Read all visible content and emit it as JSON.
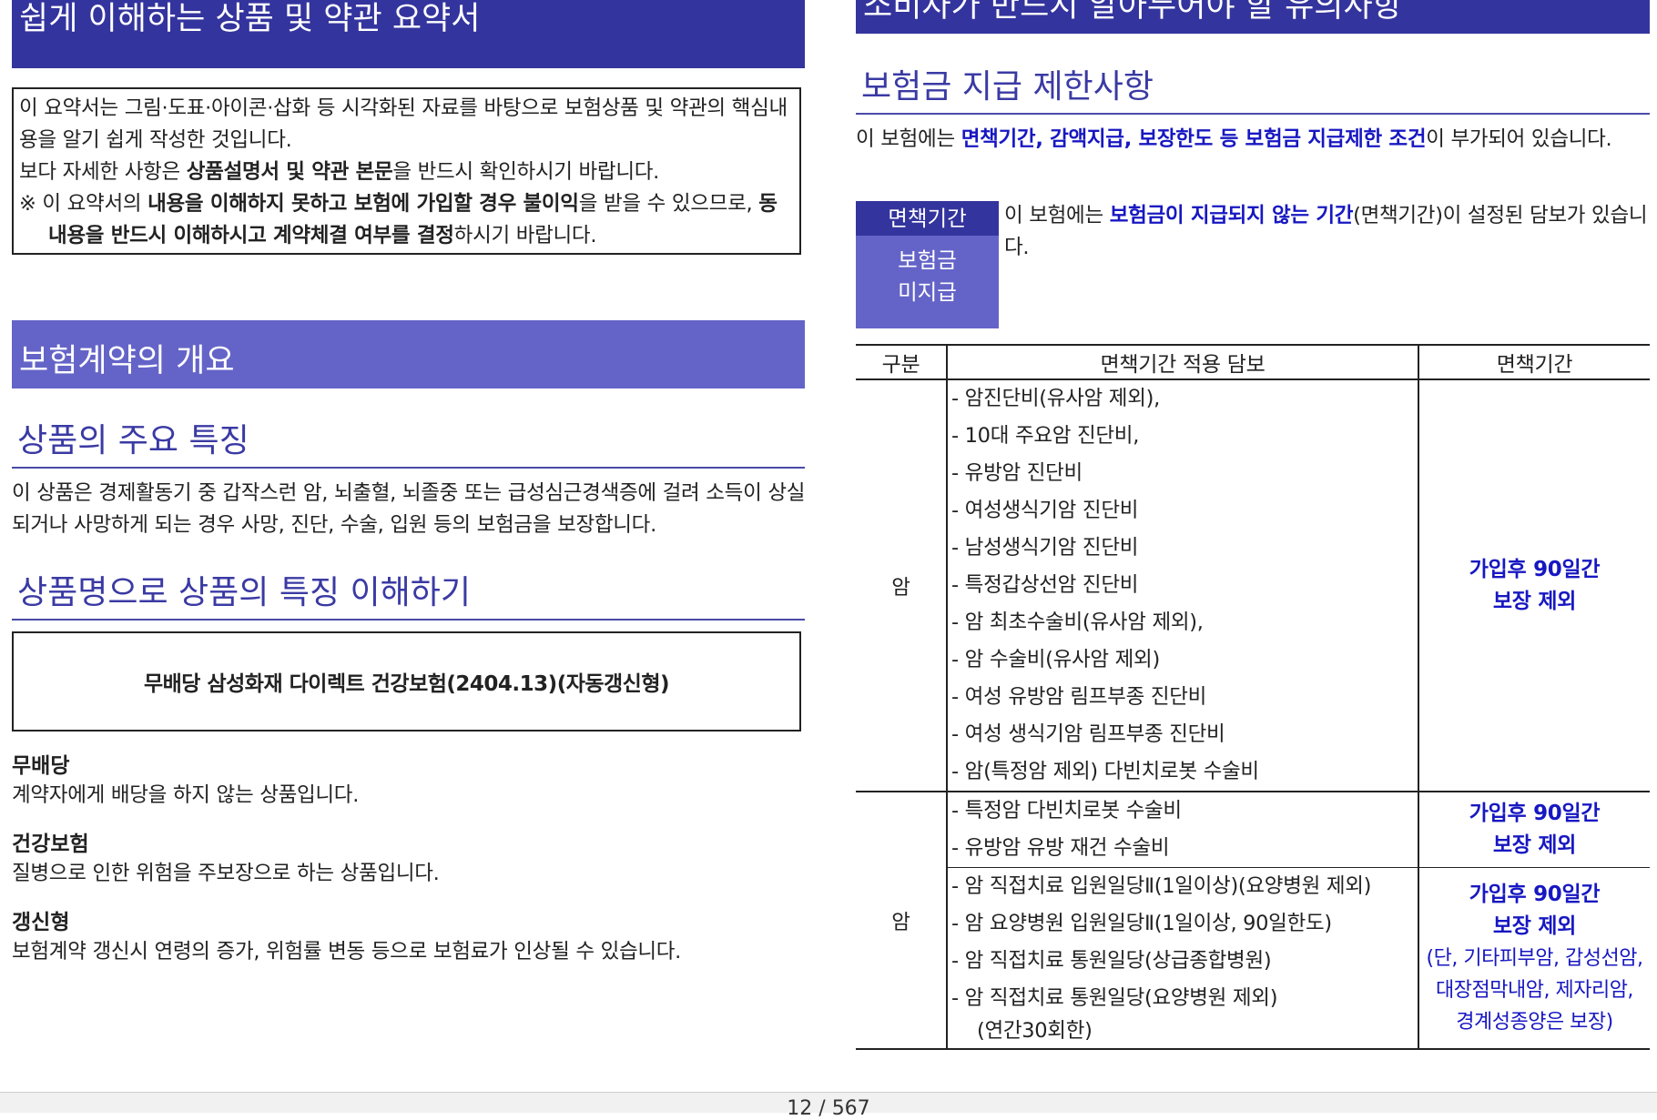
{
  "left": {
    "summary_title": "쉽게 이해하는 상품 및 약관 요약서",
    "intro": {
      "line1": "이 요약서는 그림·도표·아이콘·삽화 등 시각화된 자료를 바탕으로 보험상품 및 약관의 핵심내용을 알기 쉽게 작성한 것입니다.",
      "line2_a": "보다 자세한 사항은 ",
      "line2_b": "상품설명서 및 약관 본문",
      "line2_c": "을 반드시 확인하시기 바랍니다.",
      "note_a": "※ 이 요약서의 ",
      "note_b": "내용을 이해하지 못하고 보험에 가입할 경우 불이익",
      "note_c": "을 받을 수 있으므로, ",
      "note_d": "동 내용을 반드시 이해하시고 계약체결 여부를 결정",
      "note_e": "하시기 바랍니다."
    },
    "overview_title": "보험계약의 개요",
    "features_heading": "상품의 주요 특징",
    "features_text": "이 상품은 경제활동기 중 갑작스런 암, 뇌출혈, 뇌졸중 또는 급성심근경색증에 걸려 소득이 상실되거나 사망하게 되는 경우 사망, 진단, 수술, 입원 등의 보험금을 보장합니다.",
    "name_heading": "상품명으로 상품의 특징 이해하기",
    "product_name": "무배당 삼성화재 다이렉트 건강보험(2404.13)(자동갱신형)",
    "terms": [
      {
        "title": "무배당",
        "desc": "계약자에게 배당을 하지 않는 상품입니다."
      },
      {
        "title": "건강보험",
        "desc": "질병으로 인한 위험을 주보장으로 하는 상품입니다."
      },
      {
        "title": "갱신형",
        "desc": "보험계약 갱신시 연령의 증가, 위험률 변동 등으로 보험료가 인상될 수 있습니다."
      }
    ]
  },
  "right": {
    "notice_title": "소비자가 반드시 알아두어야 할 유의사항",
    "limit_heading": "보험금 지급 제한사항",
    "limit_text_a": "이 보험에는 ",
    "limit_text_b": "면책기간, 감액지급, 보장한도 등 보험금 지급제한 조건",
    "limit_text_c": "이 부가되어 있습니다.",
    "tag_top": "면책기간",
    "tag_line1": "보험금",
    "tag_line2": "미지급",
    "tag_text_a": "이 보험에는 ",
    "tag_text_b": "보험금이 지급되지 않는 기간",
    "tag_text_c": "(면책기간)이 설정된 담보가 있습니다.",
    "table": {
      "headers": [
        "구분",
        "면책기간 적용 담보",
        "면책기간"
      ],
      "group1": {
        "category": "암",
        "items": [
          "- 암진단비(유사암 제외),",
          "- 10대 주요암 진단비,",
          "- 유방암 진단비",
          "- 여성생식기암 진단비",
          "- 남성생식기암 진단비",
          "- 특정갑상선암 진단비",
          "- 암 최초수술비(유사암 제외),",
          "- 암 수술비(유사암 제외)",
          "- 여성 유방암 림프부종 진단비",
          "- 여성 생식기암 림프부종 진단비",
          "- 암(특정암 제외) 다빈치로봇 수술비"
        ],
        "period_1": "가입후 90일간",
        "period_2": "보장 제외"
      },
      "group2": {
        "category": "암",
        "sub1": {
          "items": [
            "- 특정암 다빈치로봇 수술비",
            "- 유방암 유방 재건 수술비"
          ],
          "period_1": "가입후 90일간",
          "period_2": "보장 제외"
        },
        "sub2": {
          "items": [
            "- 암 직접치료 입원일당Ⅱ(1일이상)(요양병원 제외)",
            "- 암 요양병원 입원일당Ⅱ(1일이상, 90일한도)",
            "- 암 직접치료 통원일당(상급종합병원)",
            "- 암 직접치료 통원일당(요양병원 제외)"
          ],
          "item_cont": "(연간30회한)",
          "period_1": "가입후 90일간",
          "period_2": "보장 제외",
          "note_1": "(단, 기타피부암, 갑성선암,",
          "note_2": "대장점막내암, 제자리암,",
          "note_3": "경계성종양은 보장)"
        }
      }
    }
  },
  "footer": {
    "page": "12 / 567"
  }
}
